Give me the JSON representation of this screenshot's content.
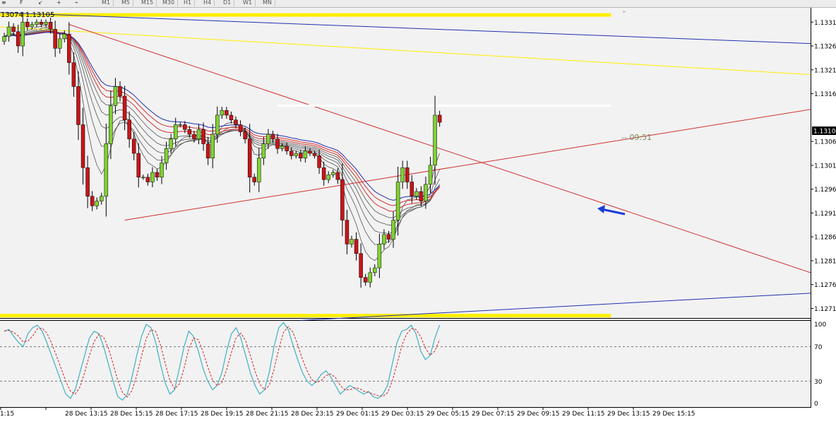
{
  "toolbar": {
    "tabs": [
      "M1",
      "M5",
      "M15",
      "M30",
      "H1",
      "H4",
      "D1",
      "W1",
      "MN"
    ]
  },
  "symbol_info": "13074 1.13105",
  "timer": "09:51",
  "chart_data": [
    {
      "type": "candlestick",
      "title": "",
      "price_ticks": [
        "1.13315",
        "1.13265",
        "1.13215",
        "1.13165",
        "1.13065",
        "1.13015",
        "1.12965",
        "1.12915",
        "1.12865",
        "1.12815",
        "1.12765",
        "1.12715"
      ],
      "ylim": [
        1.12695,
        1.13345
      ],
      "current_price": {
        "label": "1.13105",
        "value": 1.13105
      },
      "time_labels": [
        "1:15",
        "28 Dec 13:15",
        "28 Dec 15:15",
        "28 Dec 17:15",
        "28 Dec 19:15",
        "28 Dec 21:15",
        "28 Dec 23:15",
        "29 Dec 01:15",
        "29 Dec 03:15",
        "29 Dec 05:15",
        "29 Dec 07:15",
        "29 Dec 09:15",
        "29 Dec 11:15",
        "29 Dec 13:15",
        "29 Dec 15:15"
      ],
      "closes": [
        1.13285,
        1.13305,
        1.13295,
        1.13265,
        1.13315,
        1.13305,
        1.1331,
        1.13315,
        1.1331,
        1.13315,
        1.133,
        1.1326,
        1.1328,
        1.1329,
        1.1323,
        1.1318,
        1.131,
        1.1301,
        1.1295,
        1.1293,
        1.1294,
        1.1295,
        1.1306,
        1.1314,
        1.1318,
        1.1316,
        1.1311,
        1.1307,
        1.1304,
        1.1299,
        1.1299,
        1.1298,
        1.13,
        1.1299,
        1.1302,
        1.1305,
        1.1307,
        1.131,
        1.131,
        1.1309,
        1.1308,
        1.1307,
        1.1309,
        1.1306,
        1.1303,
        1.1308,
        1.1312,
        1.1313,
        1.1312,
        1.1311,
        1.131,
        1.13085,
        1.1307,
        1.1299,
        1.1298,
        1.1303,
        1.1306,
        1.1308,
        1.1307,
        1.1305,
        1.13055,
        1.13045,
        1.13035,
        1.1304,
        1.1303,
        1.13045,
        1.1304,
        1.13035,
        1.1301,
        1.12985,
        1.12995,
        1.13,
        1.12985,
        1.129,
        1.1285,
        1.1286,
        1.1283,
        1.1278,
        1.1277,
        1.1279,
        1.128,
        1.1285,
        1.1287,
        1.1286,
        1.129,
        1.1298,
        1.1301,
        1.1298,
        1.1295,
        1.1296,
        1.1294,
        1.12975,
        1.13015,
        1.1312,
        1.13105
      ],
      "ema_ribbon_count": 8,
      "stochastic": {
        "levels": [
          {
            "label": "100",
            "value": 100
          },
          {
            "label": "70",
            "value": 70
          },
          {
            "label": "30",
            "value": 30
          },
          {
            "label": "0",
            "value": 0
          }
        ],
        "ylim": [
          0,
          100
        ],
        "main": [
          88,
          90,
          82,
          75,
          70,
          85,
          92,
          95,
          88,
          75,
          60,
          45,
          30,
          15,
          10,
          20,
          40,
          60,
          80,
          88,
          85,
          70,
          50,
          30,
          12,
          8,
          15,
          35,
          60,
          82,
          96,
          92,
          75,
          50,
          28,
          15,
          20,
          45,
          70,
          88,
          82,
          65,
          45,
          30,
          20,
          25,
          40,
          65,
          85,
          92,
          80,
          60,
          40,
          25,
          15,
          20,
          40,
          70,
          92,
          98,
          90,
          72,
          55,
          40,
          30,
          25,
          30,
          38,
          42,
          35,
          25,
          15,
          20,
          25,
          22,
          18,
          15,
          18,
          12,
          10,
          15,
          25,
          50,
          75,
          88,
          90,
          95,
          85,
          65,
          55,
          60,
          80,
          95
        ]
      },
      "colors": {
        "bull": "#7fd230",
        "bear": "#c81418",
        "ema_red": "#d03030",
        "ema_blue": "#2030b0",
        "ema_gray": "#555555",
        "yellow": "#ffee00",
        "stoch_main": "#40b0c0",
        "stoch_signal": "#d02020"
      }
    }
  ]
}
